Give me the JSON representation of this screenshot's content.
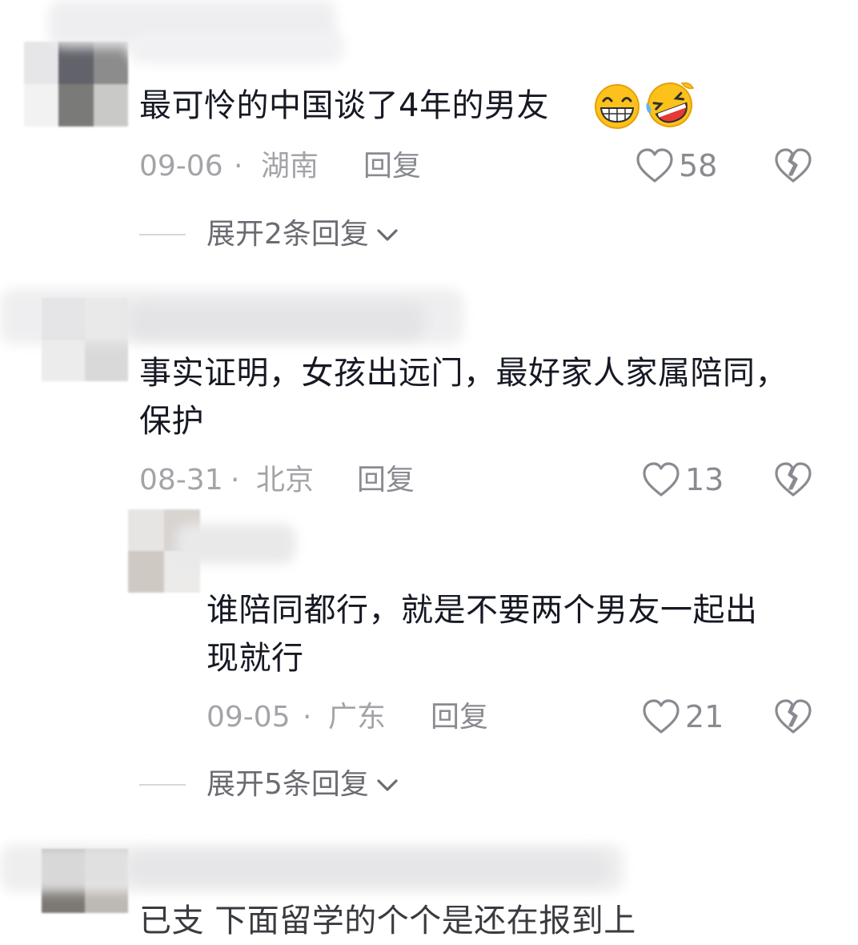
{
  "comments": [
    {
      "text": "最可怜的中国谈了4年的男友",
      "emojis": [
        "grinning-face-emoji",
        "rolling-on-floor-laughing-emoji"
      ],
      "date": "09-06",
      "separator": "·",
      "location": "湖南",
      "reply_label": "回复",
      "likes": "58",
      "expand_label": "展开2条回复"
    },
    {
      "text": "事实证明，女孩出远门，最好家人家属陪同，\n保护",
      "date": "08-31",
      "separator": "·",
      "location": "北京",
      "reply_label": "回复",
      "likes": "13",
      "replies": [
        {
          "text": "谁陪同都行，就是不要两个男友一起出\n现就行",
          "date": "09-05",
          "separator": "·",
          "location": "广东",
          "reply_label": "回复",
          "likes": "21"
        }
      ],
      "expand_label": "展开5条回复"
    },
    {
      "text": "已支 下面留学的个个是还在报到上"
    }
  ],
  "icons": {
    "like": "heart-outline-icon",
    "dislike": "broken-heart-outline-icon",
    "expand": "chevron-down-icon"
  },
  "colors": {
    "text": "#161823",
    "meta": "#a3a4a8",
    "action": "#8a8b91",
    "icon": "#8a8b91"
  }
}
